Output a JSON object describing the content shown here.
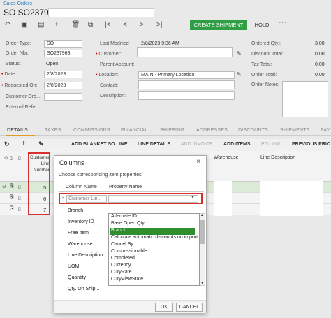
{
  "breadcrumb": "Sales Orders",
  "page_title": "SO SO237963 -",
  "toolbar": {
    "create_shipment": "CREATE SHIPMENT",
    "hold": "HOLD",
    "more": "···"
  },
  "form": {
    "order_type_label": "Order Type:",
    "order_type_value": "SO",
    "order_nbr_label": "Order Nbr.:",
    "order_nbr_value": "SO237963",
    "status_label": "Status:",
    "status_value": "Open",
    "date_label": "Date:",
    "date_value": "2/8/2023",
    "requested_on_label": "Requested On:",
    "requested_on_value": "2/8/2023",
    "customer_ord_label": "Customer Ord...",
    "external_ref_label": "External Refer...",
    "last_modified_label": "Last Modified",
    "last_modified_value": "2/8/2023 9:36 AM",
    "customer_label": "Customer:",
    "parent_account_label": "Parent Account:",
    "location_label": "Location:",
    "location_value": "MAIN - Primary Location",
    "contact_label": "Contact:",
    "description_label": "Description:",
    "ordered_qty_label": "Ordered Qty.:",
    "ordered_qty_value": "3.00",
    "discount_total_label": "Discount Total:",
    "discount_total_value": "0.00",
    "tax_total_label": "Tax Total:",
    "tax_total_value": "0.00",
    "order_total_label": "Order Total:",
    "order_total_value": "0.00",
    "order_notes_label": "Order Notes:"
  },
  "tabs": [
    "DETAILS",
    "TAXES",
    "COMMISSIONS",
    "FINANCIAL",
    "SHIPPING",
    "ADDRESSES",
    "DISCOUNTS",
    "SHIPMENTS",
    "PAY"
  ],
  "grid_toolbar": {
    "add_blanket": "ADD BLANKET SO LINE",
    "line_details": "LINE DETAILS",
    "add_invoice": "ADD INVOICE",
    "add_items": "ADD ITEMS",
    "po_link": "PO LINK",
    "previous_price": "PREVIOUS PRIC"
  },
  "grid": {
    "col_customer_line": "Customer Line Number",
    "col_warehouse": "Warehouse",
    "col_line_description": "Line Description",
    "rows": [
      {
        "line_no": "5"
      },
      {
        "line_no": "6"
      },
      {
        "line_no": "7"
      }
    ]
  },
  "dialog": {
    "title": "Columns",
    "close": "×",
    "subtitle": "Choose corresponding item properties.",
    "col_column_name": "Column Name",
    "col_property_name": "Property Name",
    "current_column": "Customer Lin...",
    "columns": [
      "Branch",
      "Inventory ID",
      "Free Item",
      "Warehouse",
      "Line Description",
      "UOM",
      "Quantity",
      "Qty. On Ship..."
    ],
    "properties": [
      {
        "label": "Alternate ID",
        "selected": false
      },
      {
        "label": "Base Open Qty.",
        "selected": false
      },
      {
        "label": "Branch",
        "selected": true
      },
      {
        "label": "Calculate automatic discounts on import",
        "selected": false
      },
      {
        "label": "Cancel By",
        "selected": false
      },
      {
        "label": "Commissionable",
        "selected": false
      },
      {
        "label": "Completed",
        "selected": false
      },
      {
        "label": "Currency",
        "selected": false
      },
      {
        "label": "CuryRate",
        "selected": false
      },
      {
        "label": "CuryViewState",
        "selected": false
      }
    ],
    "ok": "OK",
    "cancel": "CANCEL"
  },
  "colors": {
    "accent_green": "#2f9e44",
    "highlight_red": "#d9302f",
    "tab_underline": "#e39b2b",
    "selected_row": "#dcebd7"
  }
}
